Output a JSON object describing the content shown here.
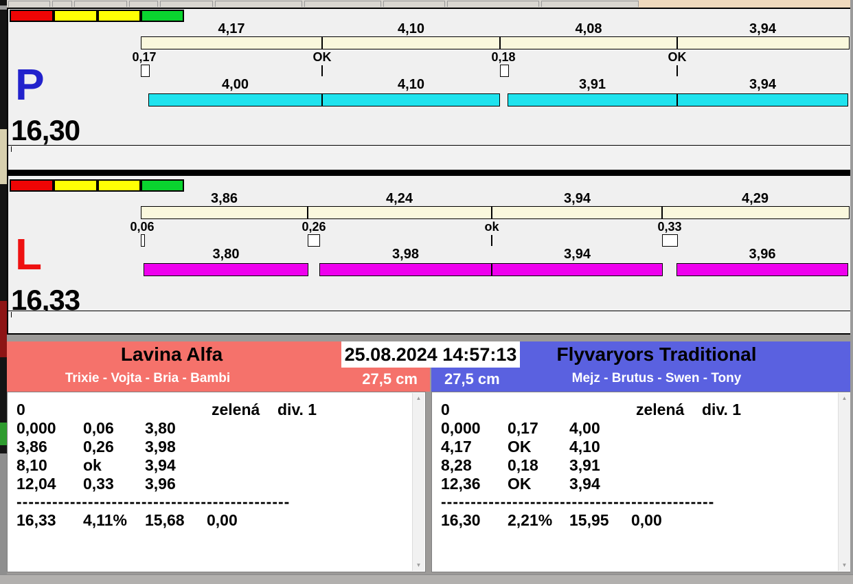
{
  "colors": {
    "cream": "#faf8dd",
    "strip": [
      "#ee0505",
      "#ffff05",
      "#ffff05",
      "#0ad42f"
    ],
    "team_left_header": "#f5726b",
    "team_right_header": "#5a61e0"
  },
  "panels": [
    {
      "letter": "P",
      "letter_color": "#2222cc",
      "total_label": "16,30",
      "bar_color": "#1fe3ee",
      "splits": [
        {
          "label": "4,17",
          "value": 4.17
        },
        {
          "label": "4,10",
          "value": 4.1
        },
        {
          "label": "4,08",
          "value": 4.08
        },
        {
          "label": "3,94",
          "value": 3.94
        }
      ],
      "passes": [
        {
          "label": "0,17",
          "value": 0.17,
          "type": "box"
        },
        {
          "label": "OK",
          "type": "tick"
        },
        {
          "label": "0,18",
          "value": 0.18,
          "type": "box"
        },
        {
          "label": "OK",
          "type": "tick"
        }
      ],
      "legs": [
        {
          "label": "4,00",
          "value": 4.0
        },
        {
          "label": "4,10",
          "value": 4.1
        },
        {
          "label": "3,91",
          "value": 3.91
        },
        {
          "label": "3,94",
          "value": 3.94
        }
      ]
    },
    {
      "letter": "L",
      "letter_color": "#ee1111",
      "total_label": "16,33",
      "bar_color": "#ee00ee",
      "splits": [
        {
          "label": "3,86",
          "value": 3.86
        },
        {
          "label": "4,24",
          "value": 4.24
        },
        {
          "label": "3,94",
          "value": 3.94
        },
        {
          "label": "4,29",
          "value": 4.29
        }
      ],
      "passes": [
        {
          "label": "0,06",
          "value": 0.06,
          "type": "box"
        },
        {
          "label": "0,26",
          "value": 0.26,
          "type": "box"
        },
        {
          "label": "ok",
          "type": "tick"
        },
        {
          "label": "0,33",
          "value": 0.33,
          "type": "box"
        }
      ],
      "legs": [
        {
          "label": "3,80",
          "value": 3.8
        },
        {
          "label": "3,98",
          "value": 3.98
        },
        {
          "label": "3,94",
          "value": 3.94
        },
        {
          "label": "3,96",
          "value": 3.96
        }
      ]
    }
  ],
  "clock": "25.08.2024 14:57:13",
  "teams": [
    {
      "name": "Lavina Alfa",
      "dogs": "Trixie - Vojta - Bria - Bambi",
      "jump_height": "27,5 cm",
      "run_number": "0",
      "card_color": "zelená",
      "division": "div. 1",
      "rows": [
        [
          "0,000",
          "0,06",
          "3,80"
        ],
        [
          "3,86",
          "0,26",
          "3,98"
        ],
        [
          "8,10",
          "ok",
          "3,94"
        ],
        [
          "12,04",
          "0,33",
          "3,96"
        ]
      ],
      "separator": "----------------------------------------------",
      "totals": [
        "16,33",
        "4,11%",
        "15,68",
        "0,00"
      ]
    },
    {
      "name": "Flyvaryors Traditional",
      "dogs": "Mejz - Brutus - Swen - Tony",
      "jump_height": "27,5 cm",
      "run_number": "0",
      "card_color": "zelená",
      "division": "div. 1",
      "rows": [
        [
          "0,000",
          "0,17",
          "4,00"
        ],
        [
          "4,17",
          "OK",
          "4,10"
        ],
        [
          "8,28",
          "0,18",
          "3,91"
        ],
        [
          "12,36",
          "OK",
          "3,94"
        ]
      ],
      "separator": "----------------------------------------------",
      "totals": [
        "16,30",
        "2,21%",
        "15,95",
        "0,00"
      ]
    }
  ],
  "icons": {
    "scroll_up": "▲",
    "scroll_down": "▼"
  }
}
